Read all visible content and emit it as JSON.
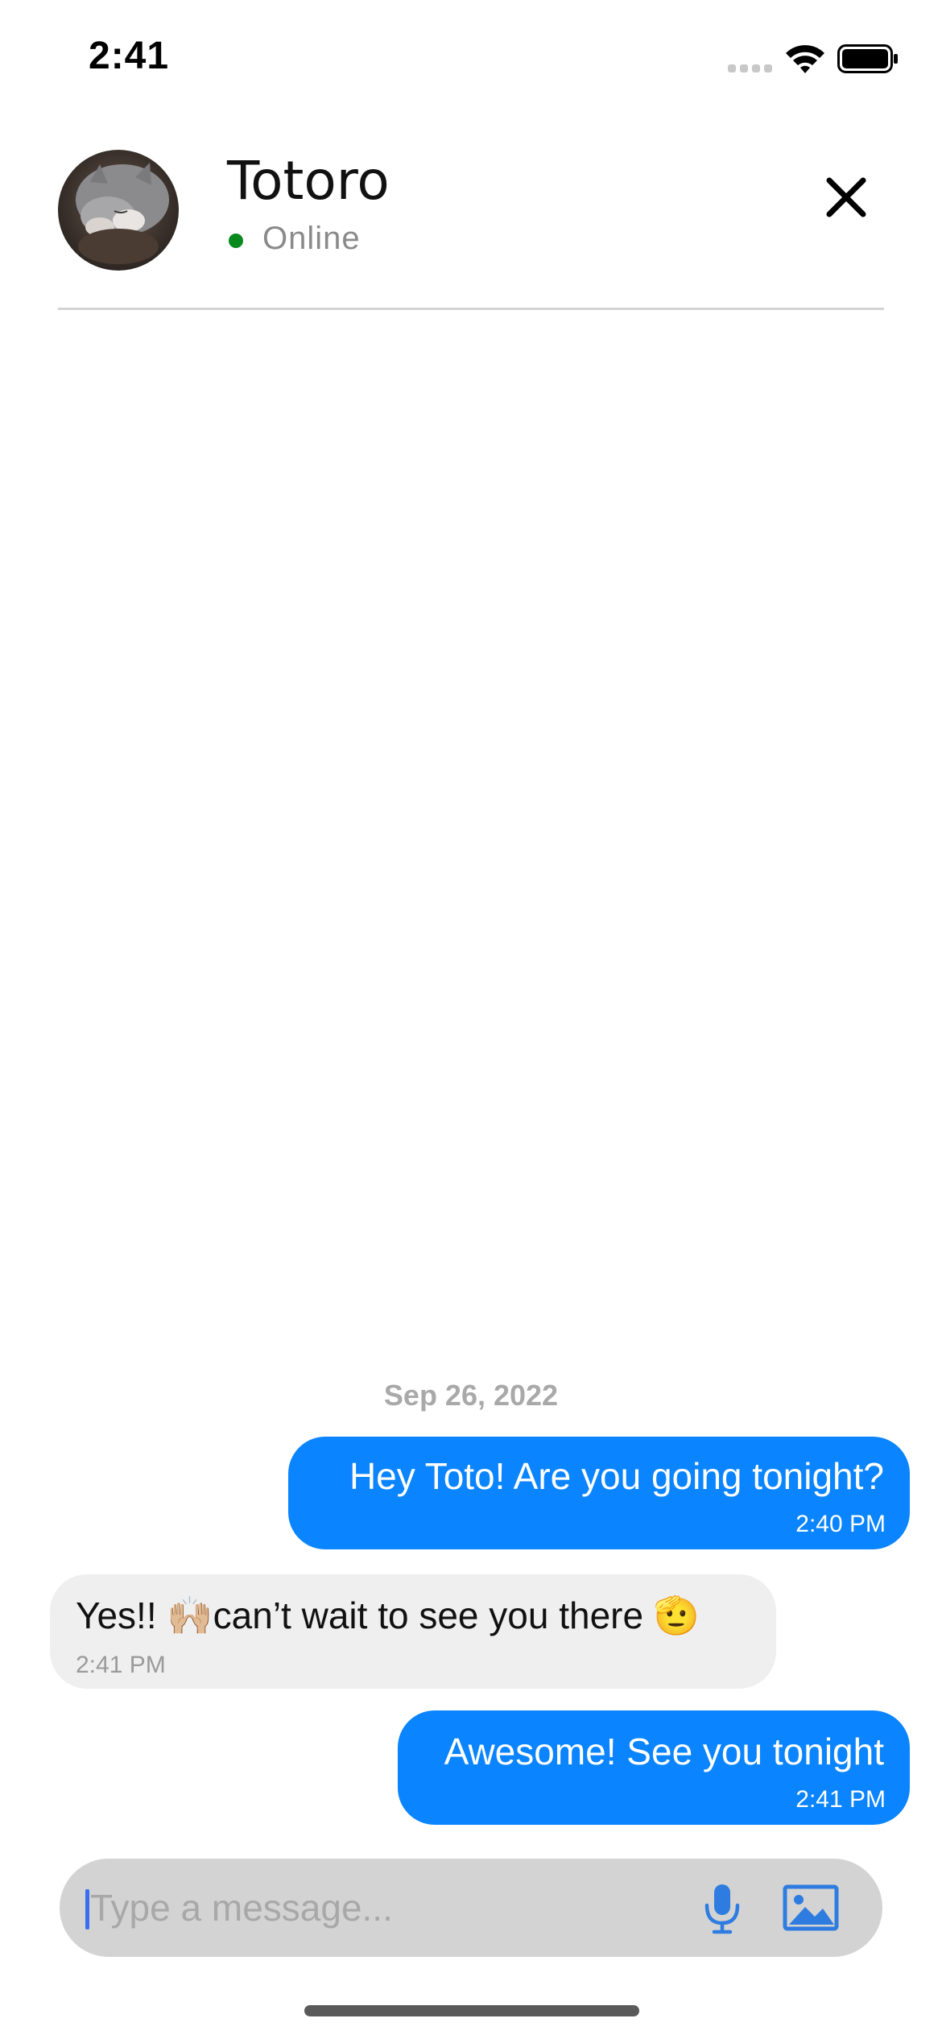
{
  "status_bar": {
    "time": "2:41",
    "icons": [
      "cellular-signal-icon",
      "wifi-icon",
      "battery-icon"
    ]
  },
  "header": {
    "contact_name": "Totoro",
    "presence": "Online",
    "presence_color": "#0a8a1e",
    "avatar": "cat-avatar",
    "close_icon": "close-icon"
  },
  "conversation": {
    "date_separator": "Sep 26, 2022",
    "messages": [
      {
        "direction": "outgoing",
        "text": "Hey Toto! Are you going tonight?",
        "time": "2:40 PM"
      },
      {
        "direction": "incoming",
        "text": "Yes!! 🙌🏼can’t wait to see you there 🫡",
        "time": "2:41 PM"
      },
      {
        "direction": "outgoing",
        "text": "Awesome! See you tonight",
        "time": "2:41 PM"
      }
    ]
  },
  "composer": {
    "placeholder": "Type a message...",
    "value": "",
    "mic_icon": "microphone-icon",
    "image_icon": "image-attach-icon"
  },
  "colors": {
    "outgoing_bubble": "#0a84ff",
    "incoming_bubble": "#efefef",
    "composer_bg": "#d3d3d3",
    "accent_icon": "#2f7ce0"
  }
}
